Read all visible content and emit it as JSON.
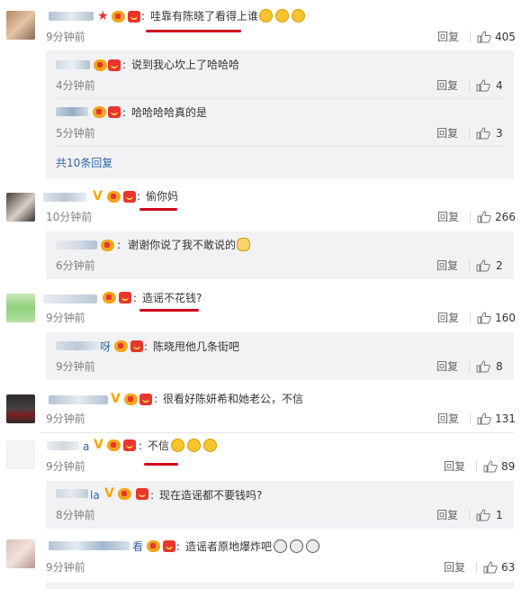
{
  "comments": [
    {
      "text": "哇靠有陈晓了看得上谁",
      "time": "9分钟前",
      "reply": "回复",
      "likes": "405",
      "replies": [
        {
          "text": "说到我心坎上了哈哈哈",
          "time": "4分钟前",
          "reply": "回复",
          "likes": "4"
        },
        {
          "text": "哈哈哈哈真的是",
          "time": "5分钟前",
          "reply": "回复",
          "likes": "3"
        }
      ],
      "more": "共10条回复"
    },
    {
      "text": "偷你妈",
      "time": "10分钟前",
      "reply": "回复",
      "likes": "266",
      "replies": [
        {
          "text": "谢谢你说了我不敢说的",
          "time": "6分钟前",
          "reply": "回复",
          "likes": "2"
        }
      ]
    },
    {
      "text": "造谣不花钱?",
      "time": "9分钟前",
      "reply": "回复",
      "likes": "160",
      "replies": [
        {
          "name_suffix": "呀",
          "text": "陈晓甩他几条街吧",
          "time": "9分钟前",
          "reply": "回复",
          "likes": "8"
        }
      ]
    },
    {
      "text": "很看好陈妍希和她老公，不信",
      "time": "9分钟前",
      "reply": "回复",
      "likes": "131"
    },
    {
      "name_suffix": "a",
      "text": "不信",
      "time": "9分钟前",
      "reply": "回复",
      "likes": "89",
      "replies": [
        {
          "name_suffix": "la",
          "text": "现在造谣都不要钱吗?",
          "time": "8分钟前",
          "reply": "回复",
          "likes": "1"
        }
      ]
    },
    {
      "name_suffix": "看",
      "text": "造谣者原地爆炸吧",
      "time": "9分钟前",
      "reply": "回复",
      "likes": "63"
    }
  ],
  "colors": {
    "link": "#3366a6",
    "highlight": "#d0021b",
    "badge": "#e8352e",
    "vip": "#f7a600"
  },
  "icons": [
    "thumb-up-icon",
    "red-envelope-badge-icon",
    "medal-badge-icon",
    "vip-v-icon"
  ]
}
